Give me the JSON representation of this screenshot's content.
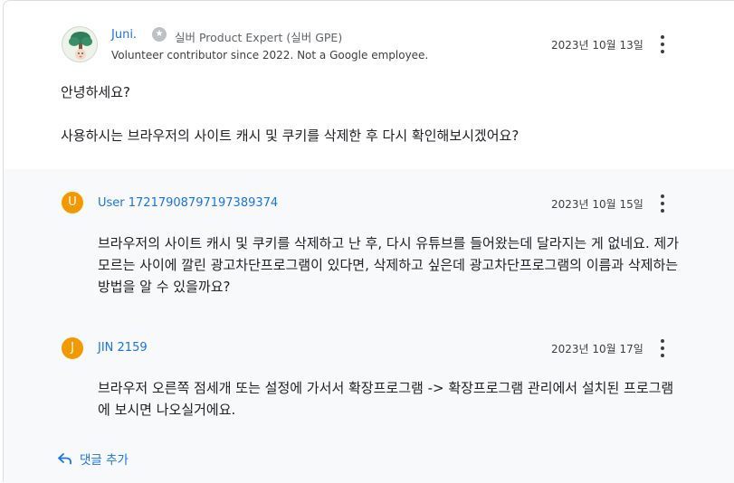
{
  "post": {
    "author": "Juni.",
    "badge_label": "실버 Product Expert (실버 GPE)",
    "subline": "Volunteer contributor since 2022. Not a Google employee.",
    "date": "2023년 10월 13일",
    "greeting": "안녕하세요?",
    "body": "사용하시는 브라우저의 사이트 캐시 및 쿠키를 삭제한 후 다시 확인해보시겠어요?"
  },
  "replies": [
    {
      "initial": "U",
      "name": "User 17217908797197389374",
      "date": "2023년 10월 15일",
      "text": "브라우저의 사이트 캐시 및 쿠키를 삭제하고 난 후, 다시 유튜브를 들어왔는데 달라지는 게 없네요. 제가 모르는 사이에 깔린 광고차단프로그램이 있다면, 삭제하고 싶은데 광고차단프로그램의 이름과 삭제하는 방법을 알 수 있을까요?"
    },
    {
      "initial": "J",
      "name": "JIN 2159",
      "date": "2023년 10월 17일",
      "text": "브라우저 오른쪽 점세개 또는 설정에 가서서 확장프로그램 -> 확장프로그램 관리에서 설치된 프로그램에 보시면 나오실거에요."
    }
  ],
  "add_reply_label": "댓글 추가",
  "colors": {
    "link": "#1a73e8",
    "reply_avatar": "#f29900",
    "reply_bg": "#f8f9fa"
  }
}
